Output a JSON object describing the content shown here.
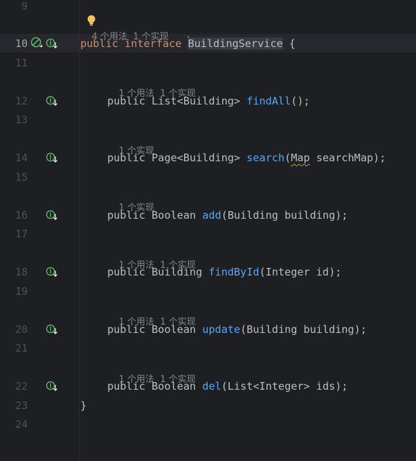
{
  "editor": {
    "line_numbers": [
      "9",
      "10",
      "11",
      "12",
      "13",
      "14",
      "15",
      "16",
      "17",
      "18",
      "19",
      "20",
      "21",
      "22",
      "23",
      "24"
    ],
    "hints": {
      "interface_usages": "4 个用法",
      "interface_impls": "1 个实现",
      "usage_1": "1 个用法",
      "impl_1": "1 个实现"
    },
    "code": {
      "interface_line": {
        "modifier": "public",
        "keyword": "interface",
        "name": "BuildingService",
        "brace": " {"
      },
      "findAll": {
        "modifier": "public",
        "type": "List<Building>",
        "name": "findAll",
        "params": "();"
      },
      "search": {
        "modifier": "public",
        "type": "Page<Building>",
        "name": "search",
        "param_type": "Map",
        "param_rest": " searchMap);"
      },
      "add": {
        "modifier": "public",
        "type": "Boolean",
        "name": "add",
        "params": "(Building building);"
      },
      "findById": {
        "modifier": "public",
        "type": "Building",
        "name": "findById",
        "params": "(Integer id);"
      },
      "update": {
        "modifier": "public",
        "type": "Boolean",
        "name": "update",
        "params": "(Building building);"
      },
      "del": {
        "modifier": "public",
        "type": "Boolean",
        "name": "del",
        "params": "(List<Integer> ids);"
      },
      "closing_brace": "}"
    },
    "icons": {
      "implemented": "implemented-gutter-icon",
      "no_impl": "interface-icon",
      "bulb": "lightbulb-icon"
    },
    "colors": {
      "background": "#1e1f22",
      "keyword": "#cf8e6d",
      "method": "#56a8f5",
      "text": "#bcbec4",
      "hint": "#86888e",
      "gutter_icon": "#5fb865"
    }
  }
}
